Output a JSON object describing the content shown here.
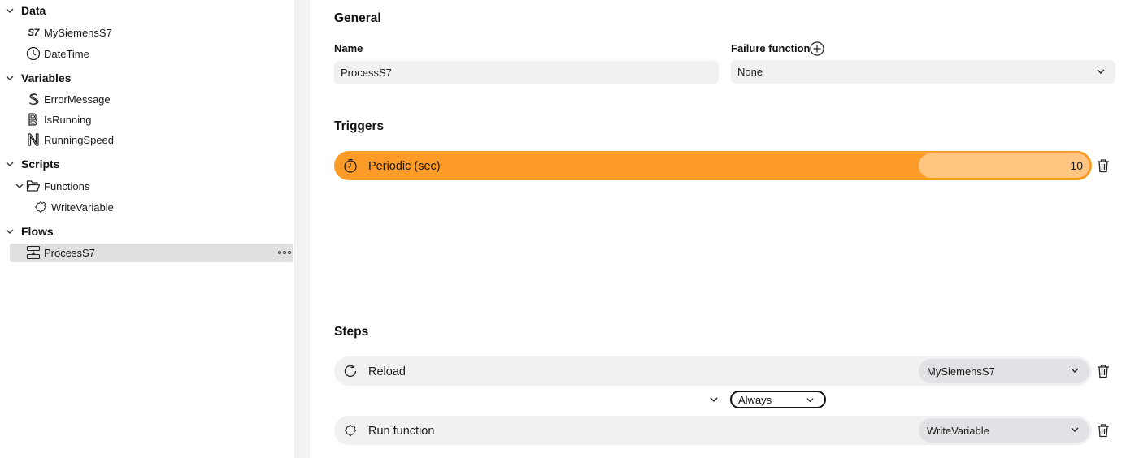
{
  "sidebar": {
    "sections": {
      "data": {
        "label": "Data"
      },
      "variables": {
        "label": "Variables"
      },
      "scripts": {
        "label": "Scripts"
      },
      "flows": {
        "label": "Flows"
      }
    },
    "data_items": [
      {
        "label": "MySiemensS7",
        "icon": "s7-icon",
        "glyph": "S7"
      },
      {
        "label": "DateTime",
        "icon": "clock-icon"
      }
    ],
    "variable_items": [
      {
        "label": "ErrorMessage",
        "icon": "string-s-icon"
      },
      {
        "label": "IsRunning",
        "icon": "boolean-b-icon"
      },
      {
        "label": "RunningSpeed",
        "icon": "number-n-icon"
      }
    ],
    "script_folder": {
      "label": "Functions",
      "icon": "folder-icon"
    },
    "script_items": [
      {
        "label": "WriteVariable",
        "icon": "function-puzzle-icon"
      }
    ],
    "flow_items": [
      {
        "label": "ProcessS7",
        "icon": "flow-icon",
        "selected": true
      }
    ]
  },
  "general": {
    "title": "General",
    "name_label": "Name",
    "name_value": "ProcessS7",
    "failure_label": "Failure function",
    "failure_value": "None"
  },
  "triggers": {
    "title": "Triggers",
    "items": [
      {
        "label": "Periodic (sec)",
        "value": "10",
        "icon": "stopwatch-icon"
      }
    ]
  },
  "steps": {
    "title": "Steps",
    "items": [
      {
        "label": "Reload",
        "target": "MySiemensS7",
        "icon": "reload-icon"
      },
      {
        "label": "Run function",
        "target": "WriteVariable",
        "icon": "function-puzzle-icon"
      }
    ],
    "condition": "Always"
  },
  "colors": {
    "trigger_bar": "#fd9b28",
    "trigger_value": "#fec681",
    "step_bar": "#f1f1f4",
    "selected_row": "#e0e0e0"
  }
}
